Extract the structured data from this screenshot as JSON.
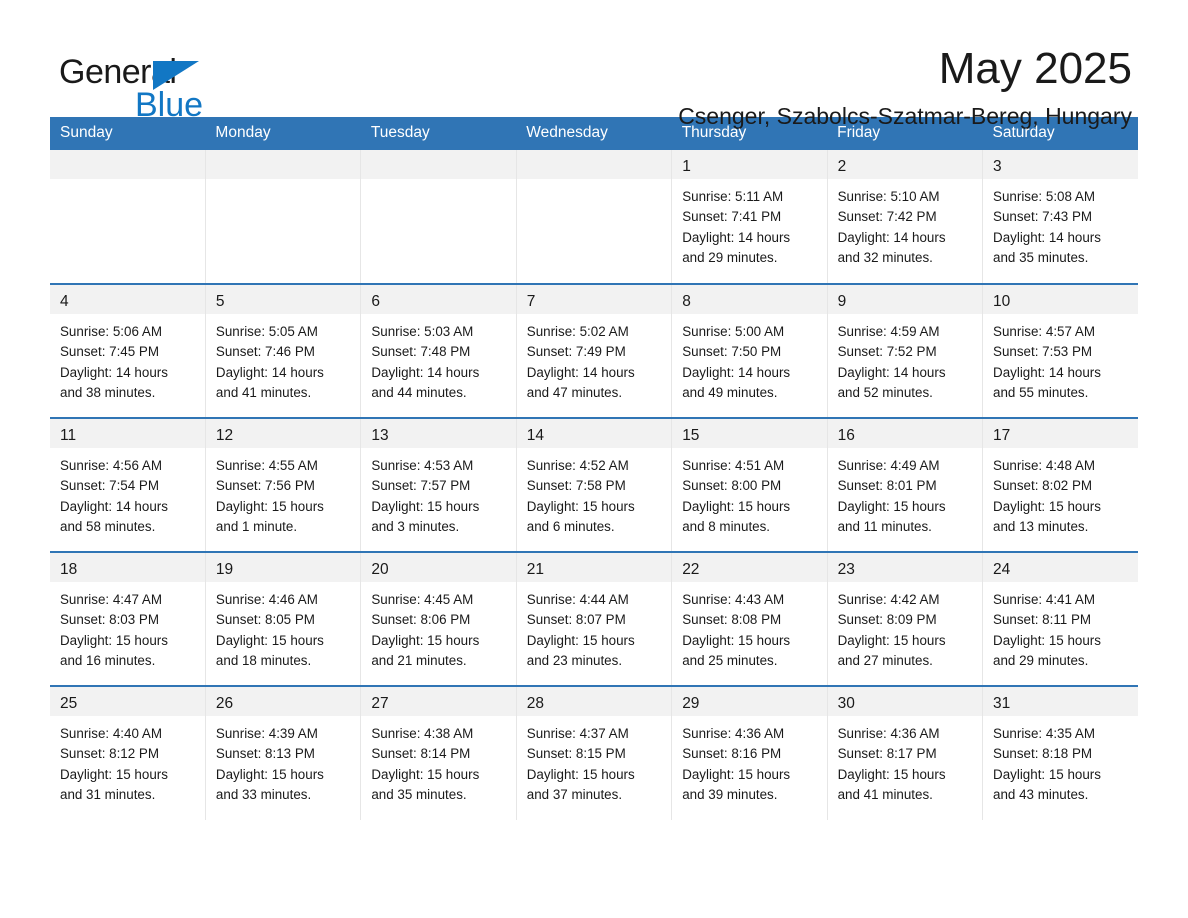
{
  "logo": {
    "text_primary": "General",
    "text_secondary": "Blue",
    "primary_color": "#1a1a1a",
    "accent_color": "#1277c4"
  },
  "header": {
    "title": "May 2025",
    "subtitle": "Csenger, Szabolcs-Szatmar-Bereg, Hungary"
  },
  "theme": {
    "header_blue": "#3075b5",
    "daynum_gray": "#f2f2f2",
    "grid_line": "#e6e6e6"
  },
  "weekday_headers": [
    "Sunday",
    "Monday",
    "Tuesday",
    "Wednesday",
    "Thursday",
    "Friday",
    "Saturday"
  ],
  "weeks": [
    [
      {
        "day": "",
        "sunrise": "",
        "sunset": "",
        "daylight_line1": "",
        "daylight_line2": ""
      },
      {
        "day": "",
        "sunrise": "",
        "sunset": "",
        "daylight_line1": "",
        "daylight_line2": ""
      },
      {
        "day": "",
        "sunrise": "",
        "sunset": "",
        "daylight_line1": "",
        "daylight_line2": ""
      },
      {
        "day": "",
        "sunrise": "",
        "sunset": "",
        "daylight_line1": "",
        "daylight_line2": ""
      },
      {
        "day": "1",
        "sunrise": "Sunrise: 5:11 AM",
        "sunset": "Sunset: 7:41 PM",
        "daylight_line1": "Daylight: 14 hours",
        "daylight_line2": "and 29 minutes."
      },
      {
        "day": "2",
        "sunrise": "Sunrise: 5:10 AM",
        "sunset": "Sunset: 7:42 PM",
        "daylight_line1": "Daylight: 14 hours",
        "daylight_line2": "and 32 minutes."
      },
      {
        "day": "3",
        "sunrise": "Sunrise: 5:08 AM",
        "sunset": "Sunset: 7:43 PM",
        "daylight_line1": "Daylight: 14 hours",
        "daylight_line2": "and 35 minutes."
      }
    ],
    [
      {
        "day": "4",
        "sunrise": "Sunrise: 5:06 AM",
        "sunset": "Sunset: 7:45 PM",
        "daylight_line1": "Daylight: 14 hours",
        "daylight_line2": "and 38 minutes."
      },
      {
        "day": "5",
        "sunrise": "Sunrise: 5:05 AM",
        "sunset": "Sunset: 7:46 PM",
        "daylight_line1": "Daylight: 14 hours",
        "daylight_line2": "and 41 minutes."
      },
      {
        "day": "6",
        "sunrise": "Sunrise: 5:03 AM",
        "sunset": "Sunset: 7:48 PM",
        "daylight_line1": "Daylight: 14 hours",
        "daylight_line2": "and 44 minutes."
      },
      {
        "day": "7",
        "sunrise": "Sunrise: 5:02 AM",
        "sunset": "Sunset: 7:49 PM",
        "daylight_line1": "Daylight: 14 hours",
        "daylight_line2": "and 47 minutes."
      },
      {
        "day": "8",
        "sunrise": "Sunrise: 5:00 AM",
        "sunset": "Sunset: 7:50 PM",
        "daylight_line1": "Daylight: 14 hours",
        "daylight_line2": "and 49 minutes."
      },
      {
        "day": "9",
        "sunrise": "Sunrise: 4:59 AM",
        "sunset": "Sunset: 7:52 PM",
        "daylight_line1": "Daylight: 14 hours",
        "daylight_line2": "and 52 minutes."
      },
      {
        "day": "10",
        "sunrise": "Sunrise: 4:57 AM",
        "sunset": "Sunset: 7:53 PM",
        "daylight_line1": "Daylight: 14 hours",
        "daylight_line2": "and 55 minutes."
      }
    ],
    [
      {
        "day": "11",
        "sunrise": "Sunrise: 4:56 AM",
        "sunset": "Sunset: 7:54 PM",
        "daylight_line1": "Daylight: 14 hours",
        "daylight_line2": "and 58 minutes."
      },
      {
        "day": "12",
        "sunrise": "Sunrise: 4:55 AM",
        "sunset": "Sunset: 7:56 PM",
        "daylight_line1": "Daylight: 15 hours",
        "daylight_line2": "and 1 minute."
      },
      {
        "day": "13",
        "sunrise": "Sunrise: 4:53 AM",
        "sunset": "Sunset: 7:57 PM",
        "daylight_line1": "Daylight: 15 hours",
        "daylight_line2": "and 3 minutes."
      },
      {
        "day": "14",
        "sunrise": "Sunrise: 4:52 AM",
        "sunset": "Sunset: 7:58 PM",
        "daylight_line1": "Daylight: 15 hours",
        "daylight_line2": "and 6 minutes."
      },
      {
        "day": "15",
        "sunrise": "Sunrise: 4:51 AM",
        "sunset": "Sunset: 8:00 PM",
        "daylight_line1": "Daylight: 15 hours",
        "daylight_line2": "and 8 minutes."
      },
      {
        "day": "16",
        "sunrise": "Sunrise: 4:49 AM",
        "sunset": "Sunset: 8:01 PM",
        "daylight_line1": "Daylight: 15 hours",
        "daylight_line2": "and 11 minutes."
      },
      {
        "day": "17",
        "sunrise": "Sunrise: 4:48 AM",
        "sunset": "Sunset: 8:02 PM",
        "daylight_line1": "Daylight: 15 hours",
        "daylight_line2": "and 13 minutes."
      }
    ],
    [
      {
        "day": "18",
        "sunrise": "Sunrise: 4:47 AM",
        "sunset": "Sunset: 8:03 PM",
        "daylight_line1": "Daylight: 15 hours",
        "daylight_line2": "and 16 minutes."
      },
      {
        "day": "19",
        "sunrise": "Sunrise: 4:46 AM",
        "sunset": "Sunset: 8:05 PM",
        "daylight_line1": "Daylight: 15 hours",
        "daylight_line2": "and 18 minutes."
      },
      {
        "day": "20",
        "sunrise": "Sunrise: 4:45 AM",
        "sunset": "Sunset: 8:06 PM",
        "daylight_line1": "Daylight: 15 hours",
        "daylight_line2": "and 21 minutes."
      },
      {
        "day": "21",
        "sunrise": "Sunrise: 4:44 AM",
        "sunset": "Sunset: 8:07 PM",
        "daylight_line1": "Daylight: 15 hours",
        "daylight_line2": "and 23 minutes."
      },
      {
        "day": "22",
        "sunrise": "Sunrise: 4:43 AM",
        "sunset": "Sunset: 8:08 PM",
        "daylight_line1": "Daylight: 15 hours",
        "daylight_line2": "and 25 minutes."
      },
      {
        "day": "23",
        "sunrise": "Sunrise: 4:42 AM",
        "sunset": "Sunset: 8:09 PM",
        "daylight_line1": "Daylight: 15 hours",
        "daylight_line2": "and 27 minutes."
      },
      {
        "day": "24",
        "sunrise": "Sunrise: 4:41 AM",
        "sunset": "Sunset: 8:11 PM",
        "daylight_line1": "Daylight: 15 hours",
        "daylight_line2": "and 29 minutes."
      }
    ],
    [
      {
        "day": "25",
        "sunrise": "Sunrise: 4:40 AM",
        "sunset": "Sunset: 8:12 PM",
        "daylight_line1": "Daylight: 15 hours",
        "daylight_line2": "and 31 minutes."
      },
      {
        "day": "26",
        "sunrise": "Sunrise: 4:39 AM",
        "sunset": "Sunset: 8:13 PM",
        "daylight_line1": "Daylight: 15 hours",
        "daylight_line2": "and 33 minutes."
      },
      {
        "day": "27",
        "sunrise": "Sunrise: 4:38 AM",
        "sunset": "Sunset: 8:14 PM",
        "daylight_line1": "Daylight: 15 hours",
        "daylight_line2": "and 35 minutes."
      },
      {
        "day": "28",
        "sunrise": "Sunrise: 4:37 AM",
        "sunset": "Sunset: 8:15 PM",
        "daylight_line1": "Daylight: 15 hours",
        "daylight_line2": "and 37 minutes."
      },
      {
        "day": "29",
        "sunrise": "Sunrise: 4:36 AM",
        "sunset": "Sunset: 8:16 PM",
        "daylight_line1": "Daylight: 15 hours",
        "daylight_line2": "and 39 minutes."
      },
      {
        "day": "30",
        "sunrise": "Sunrise: 4:36 AM",
        "sunset": "Sunset: 8:17 PM",
        "daylight_line1": "Daylight: 15 hours",
        "daylight_line2": "and 41 minutes."
      },
      {
        "day": "31",
        "sunrise": "Sunrise: 4:35 AM",
        "sunset": "Sunset: 8:18 PM",
        "daylight_line1": "Daylight: 15 hours",
        "daylight_line2": "and 43 minutes."
      }
    ]
  ]
}
